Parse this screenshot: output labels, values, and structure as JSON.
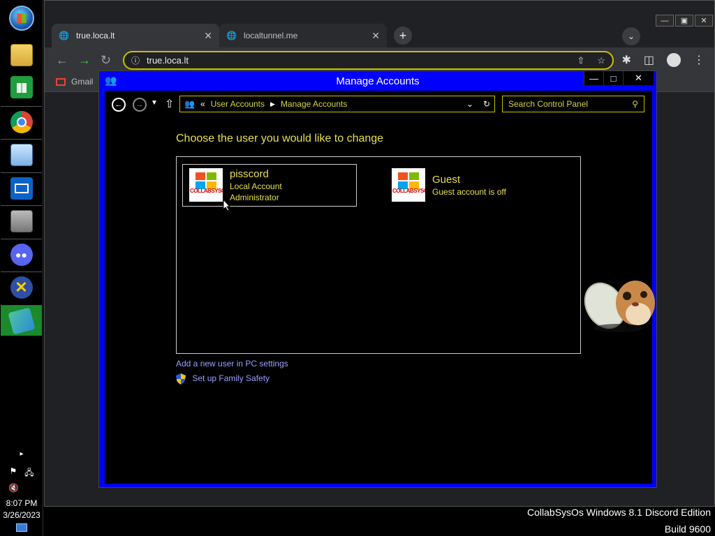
{
  "taskbar": {
    "clock_time": "8:07 PM",
    "clock_date": "3/26/2023",
    "icons": [
      "start-orb-icon",
      "file-explorer-icon",
      "store-icon",
      "chrome-icon",
      "notepad-icon",
      "mail-icon",
      "printer-icon",
      "discord-icon",
      "x-app-icon",
      "active-app-icon"
    ]
  },
  "browser": {
    "tabs": [
      {
        "label": "true.loca.lt"
      },
      {
        "label": "localtunnel.me"
      }
    ],
    "url": "true.loca.lt",
    "bookmark_gmail": "Gmail"
  },
  "control_panel": {
    "title": "Manage Accounts",
    "breadcrumb": {
      "prefix": "«",
      "item1": "User Accounts",
      "item2": "Manage Accounts"
    },
    "search_placeholder": "Search Control Panel",
    "heading": "Choose the user you would like to change",
    "accounts": [
      {
        "name": "pisscord",
        "line1": "Local Account",
        "line2": "Administrator",
        "avatar_text": "COLLABSYSOS"
      },
      {
        "name": "Guest",
        "line1": "Guest account is off",
        "line2": "",
        "avatar_text": "COLLABSYSOS"
      }
    ],
    "link_add_user": "Add a new user in PC settings",
    "link_family": "Set up Family Safety"
  },
  "desktop": {
    "watermark_line1": "CollabSysOs Windows 8.1 Discord Edition",
    "watermark_line2": "Build 9600"
  },
  "colors": {
    "cp_frame": "#0000ff",
    "accent_text": "#e6e04a",
    "link": "#9aa0ff",
    "active_taskbar": "#1a8a2a"
  }
}
